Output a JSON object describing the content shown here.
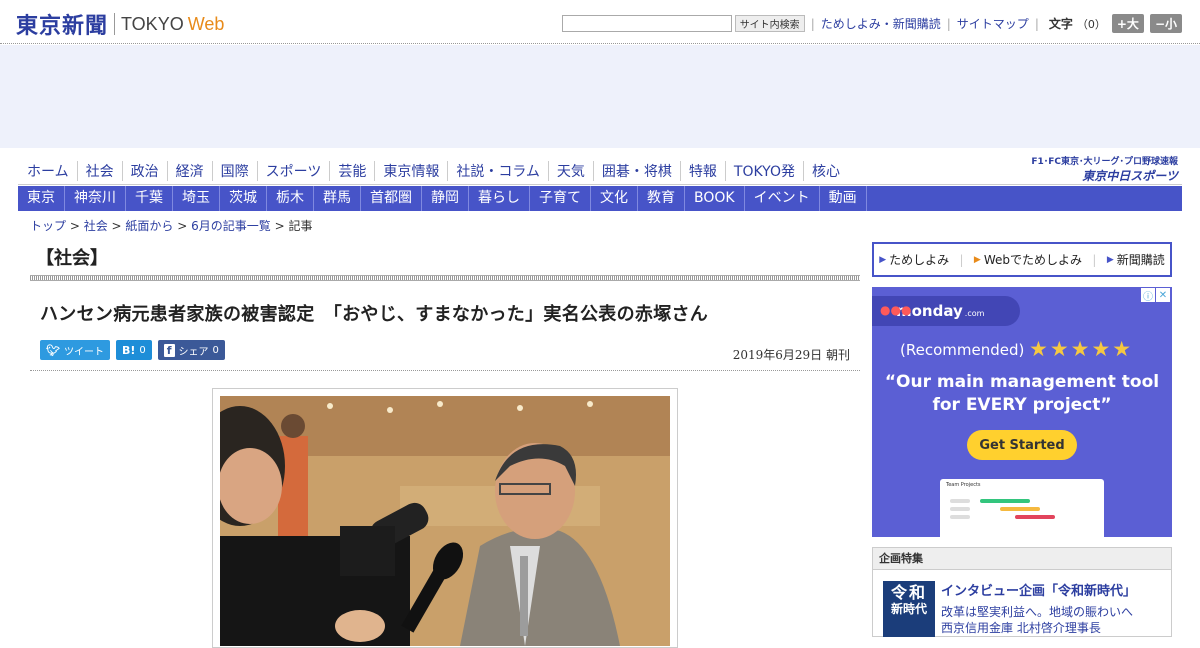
{
  "header": {
    "logo_jp": "東京新聞",
    "logo_tokyo": "TOKYO",
    "logo_web": "Web",
    "search_placeholder": "",
    "search_button": "サイト内検索",
    "link_trial": "ためしよみ・新聞購読",
    "link_sitemap": "サイトマップ",
    "fontsize_label": "文字",
    "fontsize_count": "（0）",
    "fontsize_larger": "+大",
    "fontsize_smaller": "−小"
  },
  "gnav": [
    "ホーム",
    "社会",
    "政治",
    "経済",
    "国際",
    "スポーツ",
    "芸能",
    "東京情報",
    "社説・コラム",
    "天気",
    "囲碁・将棋",
    "特報",
    "TOKYO発",
    "核心"
  ],
  "chunichi": {
    "sub": "F1･FC東京･大リーグ･プロ野球速報",
    "main": "東京中日スポーツ"
  },
  "subnav": [
    "東京",
    "神奈川",
    "千葉",
    "埼玉",
    "茨城",
    "栃木",
    "群馬",
    "首都圏",
    "静岡",
    "暮らし",
    "子育て",
    "文化",
    "教育",
    "BOOK",
    "イベント",
    "動画"
  ],
  "breadcrumb": {
    "items": [
      "トップ",
      "社会",
      "紙面から",
      "6月の記事一覧"
    ],
    "current": "記事"
  },
  "article": {
    "section": "【社会】",
    "headline": "ハンセン病元患者家族の被害認定　「おやじ、すまなかった」実名公表の赤塚さん",
    "date": "2019年6月29日 朝刊",
    "share": {
      "tweet_label": "ツイート",
      "hatena_icon": "B!",
      "hatena_count": "0",
      "fb_label": "シェア",
      "fb_count": "0"
    }
  },
  "sidebar": {
    "promo": [
      "ためしよみ",
      "Webでためしよみ",
      "新聞購読"
    ],
    "ad": {
      "brand": "monday",
      "brand_suffix": ".com",
      "recommended": "(Recommended)",
      "stars": "★★★★★",
      "headline_1": "“Our main management tool",
      "headline_2": "for EVERY project”",
      "cta": "Get Started",
      "mock_title": "Team Projects",
      "color_bg": "#5b5fd4",
      "color_cta": "#ffd02e"
    },
    "feature": {
      "head": "企画特集",
      "thumb_l1": "令和",
      "thumb_l2": "新時代",
      "title": "インタビュー企画「令和新時代」",
      "desc_1": "改革は堅実利益へ。地域の賑わいへ",
      "desc_2": "西京信用金庫 北村啓介理事長"
    }
  }
}
